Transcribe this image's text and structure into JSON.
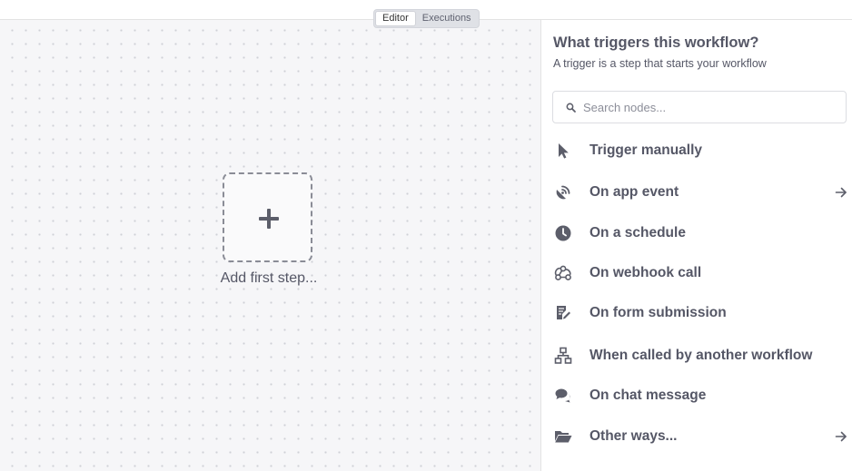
{
  "tabs": [
    {
      "label": "Editor",
      "active": true
    },
    {
      "label": "Executions",
      "active": false
    }
  ],
  "canvas": {
    "add_label": "Add first step..."
  },
  "panel": {
    "title": "What triggers this workflow?",
    "subtitle": "A trigger is a step that starts your workflow",
    "search_placeholder": "Search nodes...",
    "items": [
      {
        "label": "Trigger manually",
        "icon": "cursor-icon",
        "has_arrow": false
      },
      {
        "label": "On app event",
        "icon": "satellite-dish-icon",
        "has_arrow": true
      },
      {
        "label": "On a schedule",
        "icon": "clock-icon",
        "has_arrow": false
      },
      {
        "label": "On webhook call",
        "icon": "webhook-icon",
        "has_arrow": false
      },
      {
        "label": "On form submission",
        "icon": "form-icon",
        "has_arrow": false
      },
      {
        "label": "When called by another workflow",
        "icon": "sitemap-icon",
        "has_arrow": false
      },
      {
        "label": "On chat message",
        "icon": "chat-icon",
        "has_arrow": false
      },
      {
        "label": "Other ways...",
        "icon": "folder-open-icon",
        "has_arrow": true
      }
    ]
  },
  "colors": {
    "text": "#555766",
    "icon": "#5c5e6a",
    "canvas_bg": "#f6f6f8",
    "canvas_dots": "#cfd0d6"
  }
}
